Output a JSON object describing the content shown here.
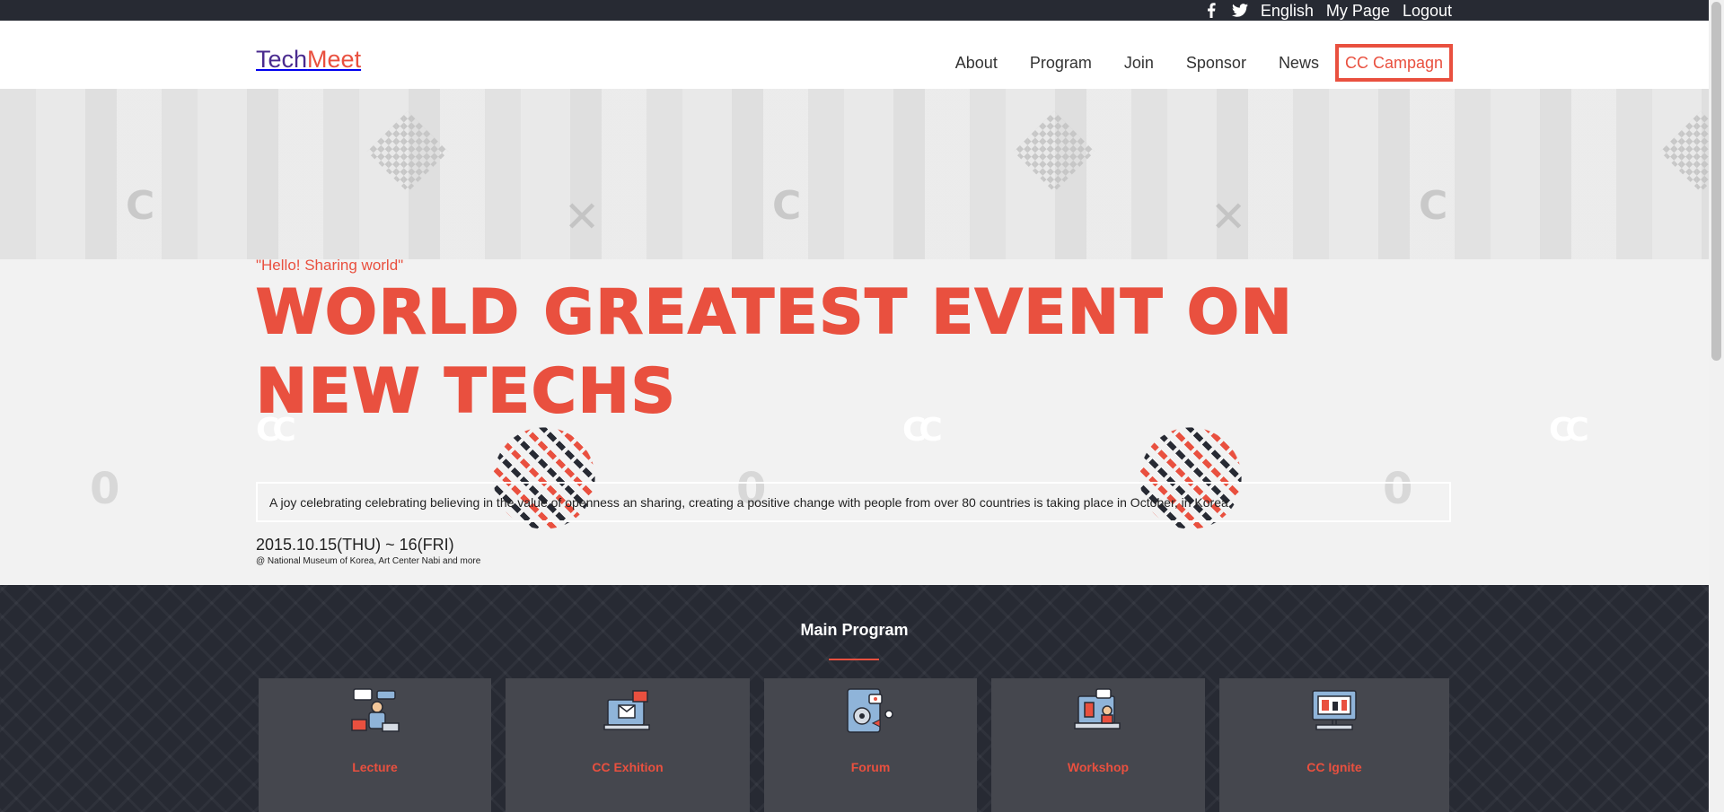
{
  "topbar": {
    "facebook_icon": "facebook-icon",
    "twitter_icon": "twitter-icon",
    "language": "English",
    "mypage": "My Page",
    "logout": "Logout"
  },
  "header": {
    "logo_part1": "Tech",
    "logo_part2": "Meet",
    "nav": {
      "about": "About",
      "program": "Program",
      "join": "Join",
      "sponsor": "Sponsor",
      "news": "News",
      "cc_campaign": "CC Campagn"
    }
  },
  "hero": {
    "tagline": "\"Hello! Sharing world\"",
    "title": "WORLD GREATEST EVENT ON NEW TECHS",
    "description": "A joy celebrating celebrating believing in the value of openness an sharing, creating a positive change with people from over 80 countries is taking place in October, in Korea.",
    "date": "2015.10.15(THU) ~ 16(FRI)",
    "venue": "@ National Museum of Korea, Art Center Nabi and more"
  },
  "program": {
    "title": "Main Program",
    "cards": [
      {
        "label": "Lecture",
        "icon": "lecture-icon"
      },
      {
        "label": "CC Exhition",
        "icon": "exhibition-icon"
      },
      {
        "label": "Forum",
        "icon": "forum-icon"
      },
      {
        "label": "Workshop",
        "icon": "workshop-icon"
      },
      {
        "label": "CC Ignite",
        "icon": "ignite-icon"
      }
    ]
  },
  "colors": {
    "accent": "#e9503f",
    "brand_purple": "#4a2b8f",
    "dark": "#272a33"
  }
}
